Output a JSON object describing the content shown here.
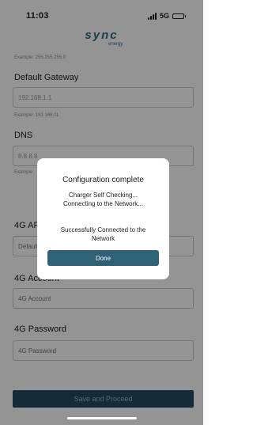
{
  "status_bar": {
    "time": "11:03",
    "network": "5G"
  },
  "logo": {
    "main": "sync",
    "sub": "energy"
  },
  "form": {
    "ip_hint": "Example: 255.255.255.0",
    "gateway": {
      "label": "Default Gateway",
      "value": "192.168.1.1",
      "hint": "Example: 192.168.11"
    },
    "dns": {
      "label": "DNS",
      "value": "8.8.8.8",
      "hint": "Example"
    },
    "apn": {
      "label": "4G APN",
      "placeholder": "Default"
    },
    "account": {
      "label": "4G Account",
      "placeholder": "4G Account"
    },
    "password": {
      "label": "4G Password",
      "placeholder": "4G Password"
    },
    "save_label": "Save and Proceed"
  },
  "dialog": {
    "title": "Configuration complete",
    "line1": "Charger Self Checking...",
    "line2": "Connecting to the Network...",
    "line3": "Successfully Connected to the",
    "line4": "Network",
    "done_label": "Done"
  },
  "colors": {
    "accent": "#2f6276",
    "save_button": "#224d5f",
    "logo": "#2f6f86"
  }
}
